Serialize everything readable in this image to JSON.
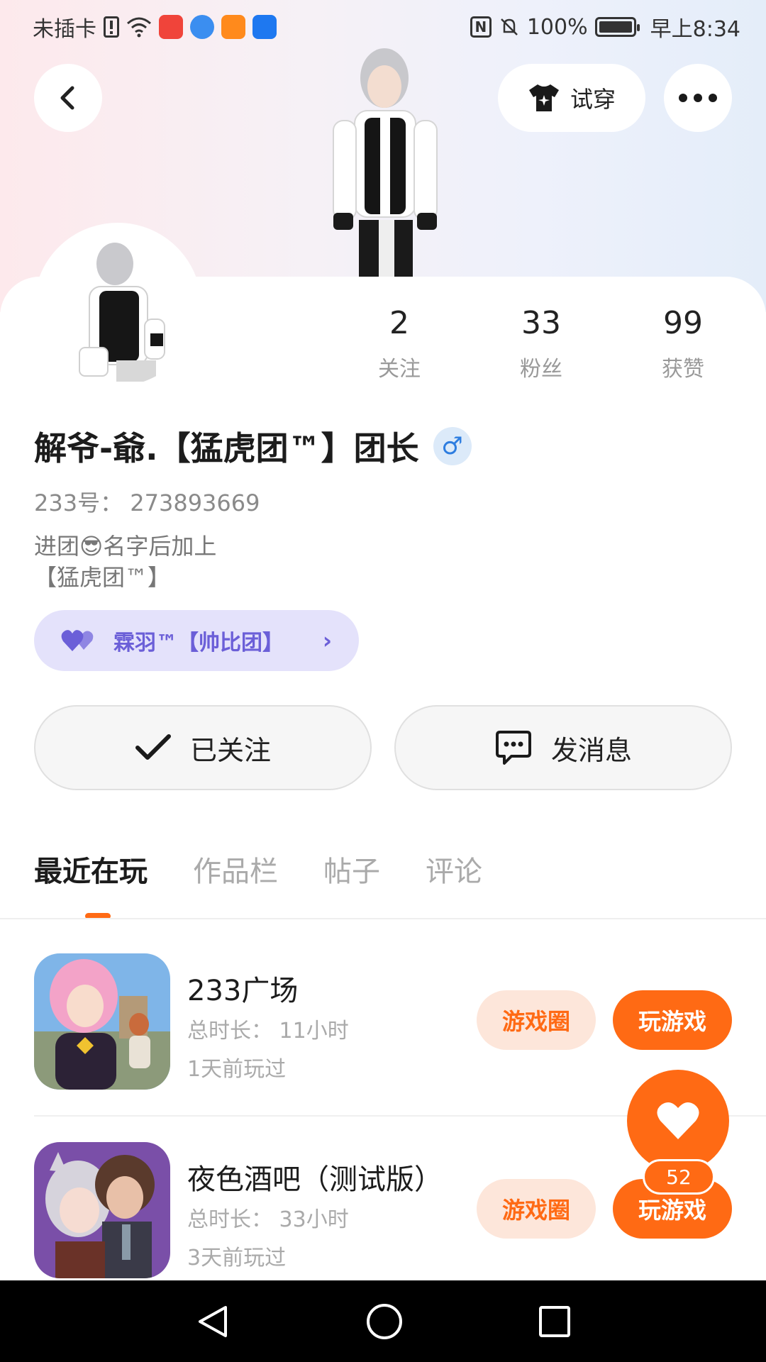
{
  "status_bar": {
    "carrier": "未插卡",
    "battery": "100%",
    "time": "早上8:34",
    "app_icons": [
      {
        "name": "app-icon-1",
        "color": "#f0443a"
      },
      {
        "name": "app-icon-2",
        "color": "#3b8ef0"
      },
      {
        "name": "app-icon-3",
        "color": "#ff8a1c"
      },
      {
        "name": "app-icon-4",
        "color": "#1e78f0"
      }
    ]
  },
  "header": {
    "try_on_label": "试穿"
  },
  "stats": [
    {
      "value": "2",
      "label": "关注"
    },
    {
      "value": "33",
      "label": "粉丝"
    },
    {
      "value": "99",
      "label": "获赞"
    }
  ],
  "profile": {
    "nickname": "解爷-爺.【猛虎团™】团长",
    "gender_symbol": "♂",
    "uid": "233号： 273893669",
    "bio": "进团😎名字后加上\n【猛虎团™】",
    "cp_label": "霖羽™【帅比团】"
  },
  "actions": {
    "follow_label": "已关注",
    "message_label": "发消息"
  },
  "tabs": [
    {
      "label": "最近在玩",
      "active": true
    },
    {
      "label": "作品栏",
      "active": false
    },
    {
      "label": "帖子",
      "active": false
    },
    {
      "label": "评论",
      "active": false
    }
  ],
  "games": [
    {
      "title": "233广场",
      "total_time": "总时长： 11小时",
      "last_played": "1天前玩过",
      "circle_label": "游戏圈",
      "play_label": "玩游戏"
    },
    {
      "title": "夜色酒吧（测试版）",
      "total_time": "总时长： 33小时",
      "last_played": "3天前玩过",
      "circle_label": "游戏圈",
      "play_label": "玩游戏"
    }
  ],
  "like_fab": {
    "count": "52"
  },
  "colors": {
    "accent": "#ff6a14",
    "cp_chip_bg": "#e4e2fb",
    "cp_chip_text": "#6b5fd8",
    "gender": "#2d7de0"
  }
}
